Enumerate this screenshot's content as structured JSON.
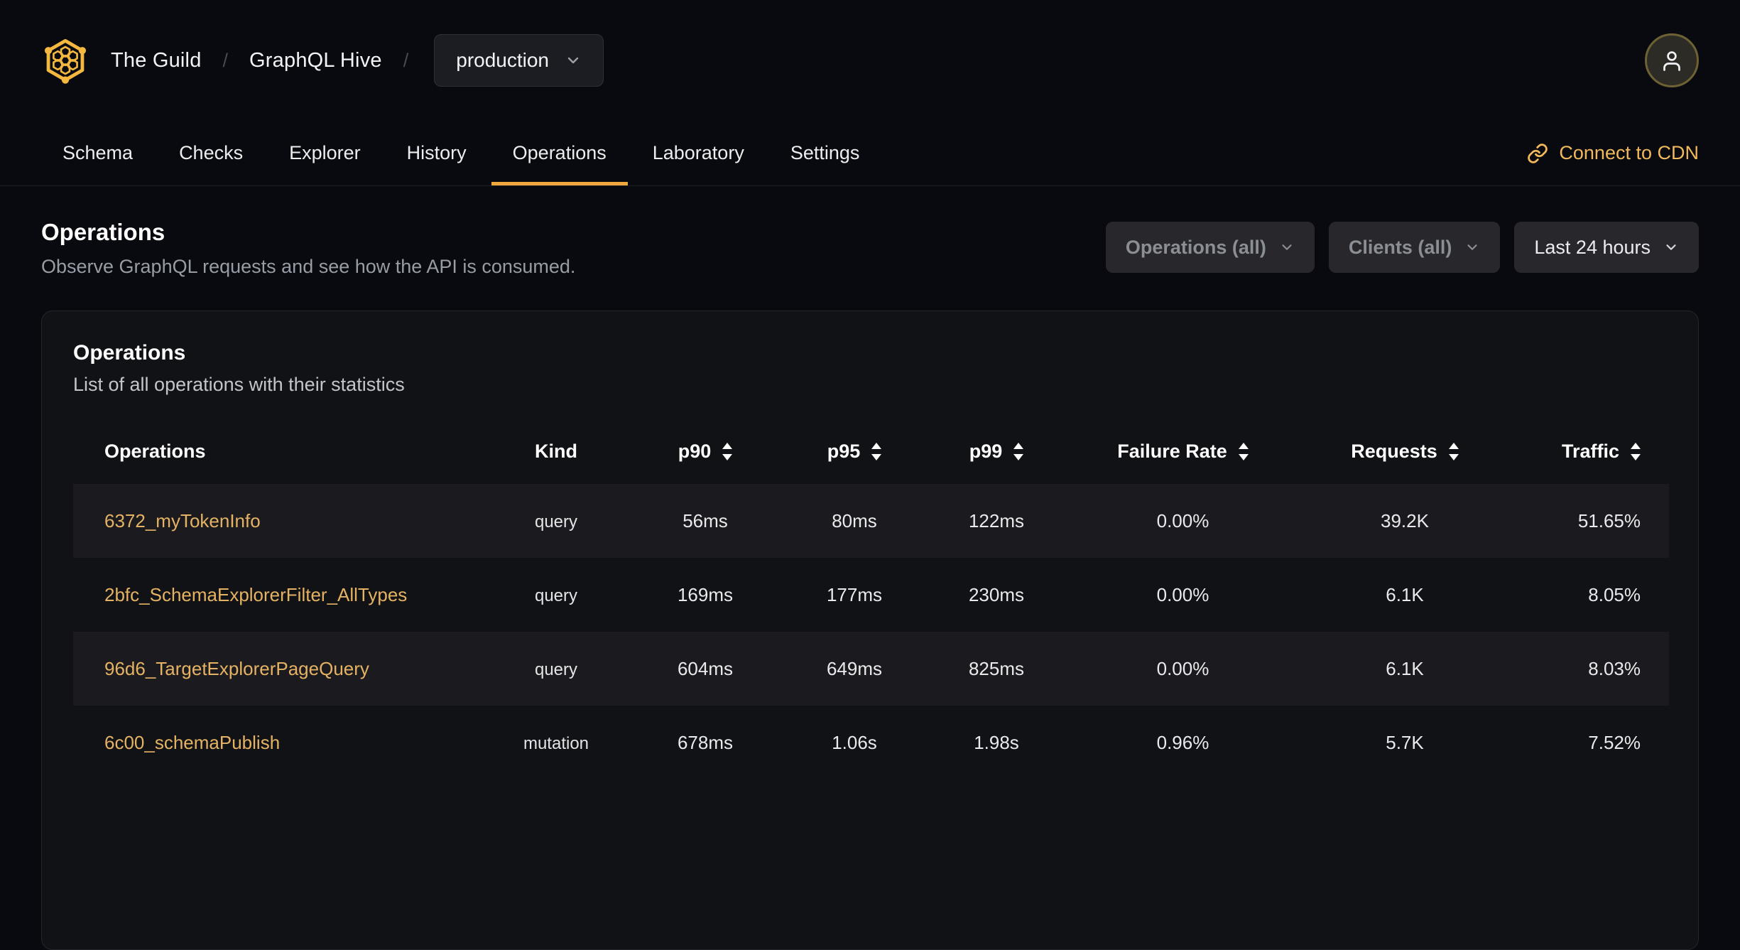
{
  "header": {
    "separator": "/",
    "breadcrumb": [
      {
        "label": "The Guild"
      },
      {
        "label": "GraphQL Hive"
      }
    ],
    "org_selector": {
      "value": "production"
    }
  },
  "nav": {
    "tabs": [
      {
        "label": "Schema",
        "active": false
      },
      {
        "label": "Checks",
        "active": false
      },
      {
        "label": "Explorer",
        "active": false
      },
      {
        "label": "History",
        "active": false
      },
      {
        "label": "Operations",
        "active": true
      },
      {
        "label": "Laboratory",
        "active": false
      },
      {
        "label": "Settings",
        "active": false
      }
    ],
    "cdn_link_label": "Connect to CDN"
  },
  "page": {
    "title": "Operations",
    "subtitle": "Observe GraphQL requests and see how the API is consumed.",
    "filters": [
      {
        "label": "Operations (all)",
        "muted": true
      },
      {
        "label": "Clients (all)",
        "muted": true
      },
      {
        "label": "Last 24 hours",
        "muted": false
      }
    ]
  },
  "card": {
    "title": "Operations",
    "subtitle": "List of all operations with their statistics",
    "table": {
      "columns": [
        {
          "label": "Operations",
          "sortable": false
        },
        {
          "label": "Kind",
          "sortable": false
        },
        {
          "label": "p90",
          "sortable": true
        },
        {
          "label": "p95",
          "sortable": true
        },
        {
          "label": "p99",
          "sortable": true
        },
        {
          "label": "Failure Rate",
          "sortable": true
        },
        {
          "label": "Requests",
          "sortable": true
        },
        {
          "label": "Traffic",
          "sortable": true
        }
      ],
      "rows": [
        {
          "operation": "6372_myTokenInfo",
          "kind": "query",
          "p90": "56ms",
          "p95": "80ms",
          "p99": "122ms",
          "failure_rate": "0.00%",
          "requests": "39.2K",
          "traffic": "51.65%"
        },
        {
          "operation": "2bfc_SchemaExplorerFilter_AllTypes",
          "kind": "query",
          "p90": "169ms",
          "p95": "177ms",
          "p99": "230ms",
          "failure_rate": "0.00%",
          "requests": "6.1K",
          "traffic": "8.05%"
        },
        {
          "operation": "96d6_TargetExplorerPageQuery",
          "kind": "query",
          "p90": "604ms",
          "p95": "649ms",
          "p99": "825ms",
          "failure_rate": "0.00%",
          "requests": "6.1K",
          "traffic": "8.03%"
        },
        {
          "operation": "6c00_schemaPublish",
          "kind": "mutation",
          "p90": "678ms",
          "p95": "1.06s",
          "p99": "1.98s",
          "failure_rate": "0.96%",
          "requests": "5.7K",
          "traffic": "7.52%"
        }
      ]
    }
  },
  "colors": {
    "accent": "#f4b740",
    "active_tab_underline": "#f0a83e",
    "link_gold": "#e5b264",
    "cdn_gold": "#f2b85c",
    "page_background": "#080a0f",
    "card_background": "#111216",
    "row_highlight": "#1b1b1f"
  }
}
